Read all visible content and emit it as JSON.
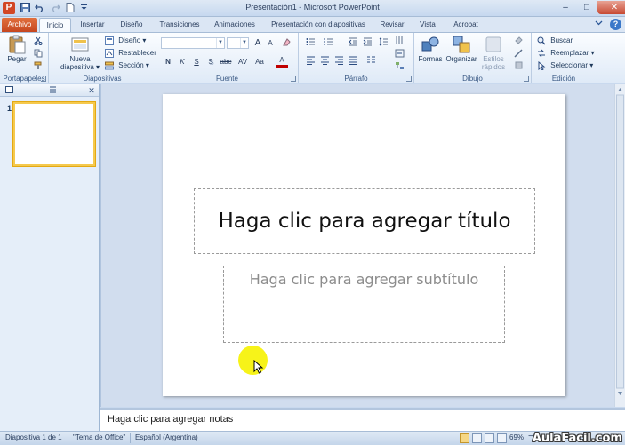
{
  "window": {
    "title": "Presentación1 - Microsoft PowerPoint",
    "app_icon_letter": "P",
    "minimize_glyph": "–",
    "maximize_glyph": "□",
    "close_glyph": "✕"
  },
  "ribbon_tabs": [
    "Archivo",
    "Inicio",
    "Insertar",
    "Diseño",
    "Transiciones",
    "Animaciones",
    "Presentación con diapositivas",
    "Revisar",
    "Vista",
    "Acrobat"
  ],
  "ribbon": {
    "portapapeles": {
      "label": "Portapapeles",
      "pegar": "Pegar"
    },
    "diapositivas": {
      "label": "Diapositivas",
      "nueva_line1": "Nueva",
      "nueva_line2": "diapositiva ▾",
      "diseno": "Diseño ▾",
      "restablecer": "Restablecer",
      "seccion": "Sección ▾"
    },
    "fuente": {
      "label": "Fuente",
      "bold": "N",
      "italic": "K",
      "underline": "S",
      "strike": "S",
      "abc": "abc",
      "spacing": "AV",
      "case": "Aa",
      "grow": "A",
      "shrink": "A",
      "color": "A"
    },
    "parrafo": {
      "label": "Párrafo"
    },
    "dibujo": {
      "label": "Dibujo",
      "formas": "Formas",
      "organizar": "Organizar",
      "estilos_line1": "Estilos",
      "estilos_line2": "rápidos"
    },
    "edicion": {
      "label": "Edición",
      "buscar": "Buscar",
      "reemplazar": "Reemplazar ▾",
      "seleccionar": "Seleccionar ▾"
    }
  },
  "slides_panel": {
    "close_glyph": "✕",
    "slide_number": "1"
  },
  "slide": {
    "title_placeholder": "Haga clic para agregar título",
    "subtitle_placeholder": "Haga clic para agregar subtítulo"
  },
  "notes": {
    "placeholder": "Haga clic para agregar notas"
  },
  "statusbar": {
    "slide_info": "Diapositiva 1 de 1",
    "theme": "\"Tema de Office\"",
    "language": "Español (Argentina)",
    "zoom": "69%",
    "zoom_minus": "−",
    "zoom_plus": "+"
  },
  "watermark": "AulaFacil.com",
  "colors": {
    "archivo_tab": "#c5461f",
    "cursor_highlight": "#f6f205",
    "selected_thumb_border": "#f5c94e"
  }
}
